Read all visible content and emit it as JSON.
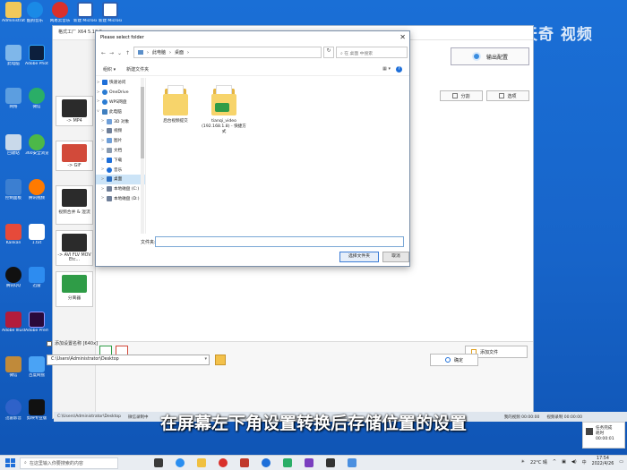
{
  "watermark": "天奇 视频",
  "subtitle": "在屏幕左下角设置转换后存储位置的设置",
  "desktop_icons": [
    {
      "label": "Administrator"
    },
    {
      "label": "酷狗音乐"
    },
    {
      "label": "网易云音乐"
    },
    {
      "label": "新建 Microsoft"
    },
    {
      "label": "新建 Microsoft"
    },
    {
      "label": "此电脑"
    },
    {
      "label": "Adobe Photosh"
    },
    {
      "label": "网络"
    },
    {
      "label": "微信"
    },
    {
      "label": "回收站"
    },
    {
      "label": "360安全浏览器"
    },
    {
      "label": "控制面板"
    },
    {
      "label": "腾讯视频"
    },
    {
      "label": "Kankan"
    },
    {
      "label": "1.txt"
    },
    {
      "label": "腾讯QQ"
    },
    {
      "label": "迅雷"
    },
    {
      "label": "Adobe Illustrator"
    },
    {
      "label": "Adobe Premiere"
    },
    {
      "label": "微信"
    },
    {
      "label": "百度网盘"
    },
    {
      "label": "迅雷影音"
    },
    {
      "label": "剪映专业版"
    }
  ],
  "app": {
    "title": "格式工厂 X64 5.10.0",
    "export_button": "输出配置",
    "split_button": "分割",
    "options_button": "选项",
    "add_file_button": "添加文件",
    "ok_button": "确定",
    "option_label": "添加设置名称 [640x]",
    "output_path": "C:\\Users\\Administrator\\Desktop",
    "side_tiles": [
      {
        "label": "-> MP4"
      },
      {
        "label": "-> GIF"
      },
      {
        "label": "视频合并 & 混流"
      },
      {
        "label": "-> AVI FLV MOV Etc..."
      },
      {
        "label": "分离器"
      }
    ]
  },
  "dialog": {
    "title": "Please select folder",
    "close": "✕",
    "breadcrumb": [
      "此电脑",
      "桌面"
    ],
    "search_placeholder": "在 桌面 中搜索",
    "toolbar": {
      "organize": "组织 ▾",
      "new_folder": "新建文件夹",
      "view": "▦ ▾",
      "help": "?"
    },
    "tree": [
      {
        "label": "快速访问",
        "icon_color": "#1e6fd9",
        "chev": ">"
      },
      {
        "label": "OneDrive",
        "icon_color": "#2b7cd3",
        "chev": ">"
      },
      {
        "label": "WPS网盘",
        "icon_color": "#2b7cd3",
        "chev": ">"
      },
      {
        "label": "此电脑",
        "icon_color": "#3f7fbf",
        "chev": "v"
      },
      {
        "label": "3D 对象",
        "icon_color": "#6f9fd8",
        "chev": ">"
      },
      {
        "label": "视频",
        "icon_color": "#6f7f99",
        "chev": ">"
      },
      {
        "label": "图片",
        "icon_color": "#6f9fd8",
        "chev": ">"
      },
      {
        "label": "文档",
        "icon_color": "#8a9bb0",
        "chev": ">"
      },
      {
        "label": "下载",
        "icon_color": "#1e6fd9",
        "chev": ">"
      },
      {
        "label": "音乐",
        "icon_color": "#1e6fd9",
        "chev": ">"
      },
      {
        "label": "桌面",
        "icon_color": "#2b6fc2",
        "chev": ">",
        "selected": true
      },
      {
        "label": "本地磁盘 (C:)",
        "icon_color": "#6f7f99",
        "chev": ">"
      },
      {
        "label": "本地磁盘 (D:)",
        "icon_color": "#6f7f99",
        "chev": ">"
      }
    ],
    "files": [
      {
        "label": "后台视频提交"
      },
      {
        "label": "tianqi_video (192.168.1.8) - 快捷方式"
      }
    ],
    "filename_label": "文件夹:",
    "select_button": "选择文件夹",
    "cancel_button": "取消"
  },
  "open_windows": [
    "C:\\Users\\Administrator\\Desktop",
    "微信录制中",
    "我的视频 00:00:00",
    "视频录制 00:00:00"
  ],
  "notification": {
    "title": "任务完成",
    "time": "耗时 00:00:01"
  },
  "taskbar": {
    "search_placeholder": "在这里输入你要搜索的内容",
    "weather": "22°C 晴",
    "time": "17:54",
    "date": "2022/4/26",
    "ime": "中"
  }
}
